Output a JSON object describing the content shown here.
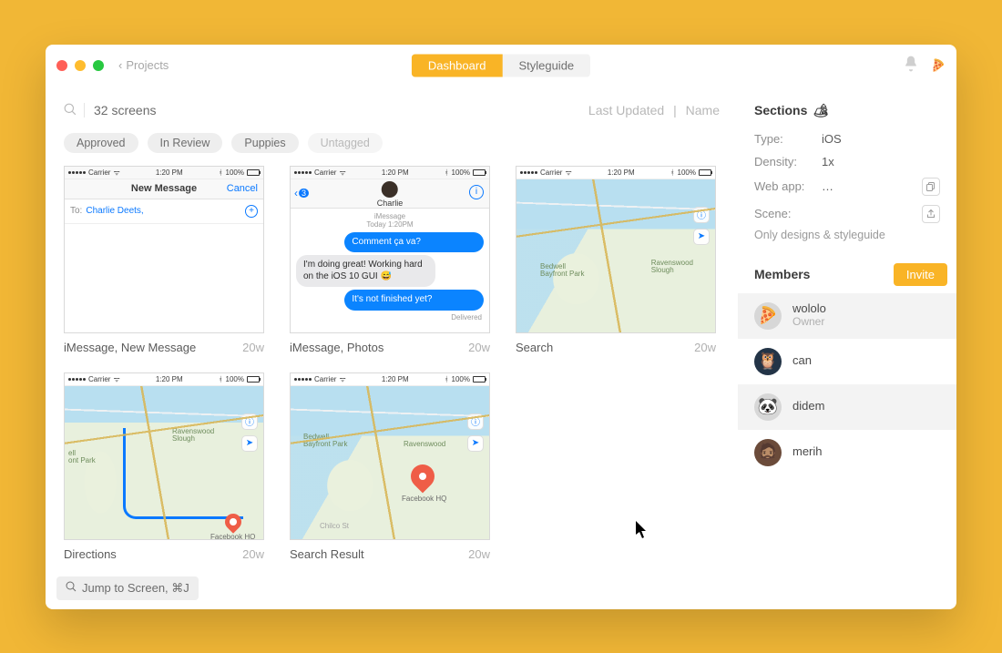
{
  "titlebar": {
    "back_label": "Projects",
    "tabs": [
      "Dashboard",
      "Styleguide"
    ],
    "active_tab_index": 0
  },
  "header": {
    "screens_count": "32 screens",
    "sort_left": "Last Updated",
    "sort_right": "Name"
  },
  "tags": [
    "Approved",
    "In Review",
    "Puppies",
    "Untagged"
  ],
  "ios_status": {
    "carrier": "Carrier",
    "wifi_glyph": "ᯤ",
    "time": "1:20 PM",
    "bt_glyph": "ᚼ",
    "batt_pct": "100%"
  },
  "screens": [
    {
      "title": "iMessage, New Message",
      "time": "20w",
      "nm": {
        "nav_title": "New Message",
        "cancel": "Cancel",
        "to_label": "To:",
        "to_name": "Charlie Deets,"
      }
    },
    {
      "title": "iMessage, Photos",
      "time": "20w",
      "chat": {
        "badge": "3",
        "name": "Charlie",
        "meta1": "iMessage",
        "meta2": "Today 1:20PM",
        "m1": "Comment ça va?",
        "m2_html": "I'm doing great! Working hard on the iOS 10 GUI 😅",
        "m3": "It's not finished yet?",
        "delivered": "Delivered"
      }
    },
    {
      "title": "Search",
      "time": "20w",
      "map": {
        "label1": "Bedwell\nBayfront Park",
        "label2": "Ravenswood\nSlough"
      }
    },
    {
      "title": "Directions",
      "time": "20w",
      "map": {
        "label1": "ell\nont Park",
        "label2": "Ravenswood\nSlough",
        "pin_label": "Facebook HQ"
      }
    },
    {
      "title": "Search Result",
      "time": "20w",
      "map": {
        "label1": "Bedwell\nBayfront Park",
        "label2": "Ravenswood",
        "pin_label": "Facebook HQ",
        "street": "Chilco St"
      }
    }
  ],
  "sidebar": {
    "sections_label": "Sections",
    "sections_emoji": "🏕",
    "rows": {
      "type_k": "Type:",
      "type_v": "iOS",
      "density_k": "Density:",
      "density_v": "1x",
      "webapp_k": "Web app:",
      "webapp_v": "…",
      "scene_k": "Scene:",
      "scene_v": "Only designs & styleguide"
    },
    "members_label": "Members",
    "invite_label": "Invite",
    "members": [
      {
        "name": "wololo",
        "role": "Owner",
        "emoji": "🍕"
      },
      {
        "name": "can",
        "role": "",
        "emoji": "🦉"
      },
      {
        "name": "didem",
        "role": "",
        "emoji": "🐼"
      },
      {
        "name": "merih",
        "role": "",
        "emoji": "🧔🏽"
      }
    ]
  },
  "footer": {
    "jump_label": "Jump to Screen, ⌘J"
  }
}
